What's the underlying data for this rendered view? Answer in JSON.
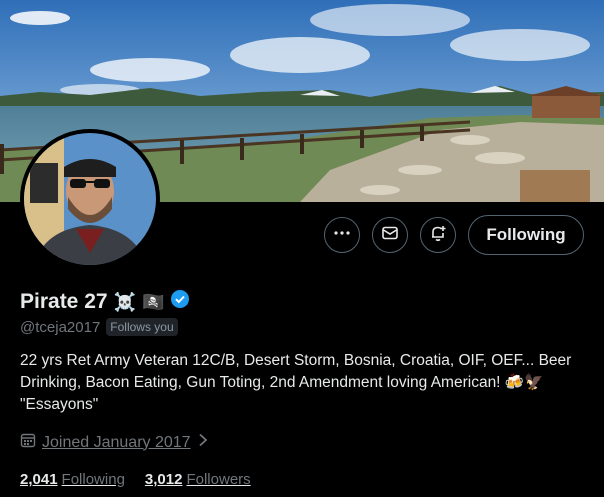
{
  "profile": {
    "name": "Pirate 27",
    "name_emoji_1": "☠️",
    "name_emoji_2": "🏴‍☠️",
    "handle": "@tceja2017",
    "follows_you_badge": "Follows you",
    "bio_text": "22 yrs Ret Army Veteran 12C/B, Desert Storm, Bosnia, Croatia, OIF, OEF... Beer Drinking, Bacon Eating, Gun Toting, 2nd Amendment loving American! 🍻🦅 \"Essayons\"",
    "joined": "Joined January 2017",
    "following_count": "2,041",
    "following_label": "Following",
    "followers_count": "3,012",
    "followers_label": "Followers",
    "verified_icon": "verified-badge-icon"
  },
  "actions": {
    "more_icon": "more-icon",
    "message_icon": "mail-icon",
    "notify_icon": "bell-plus-icon",
    "follow_button_label": "Following"
  },
  "colors": {
    "background": "#000000",
    "text_primary": "#e7e9ea",
    "text_secondary": "#71767b",
    "verified": "#1d9bf0",
    "border": "#536471"
  }
}
